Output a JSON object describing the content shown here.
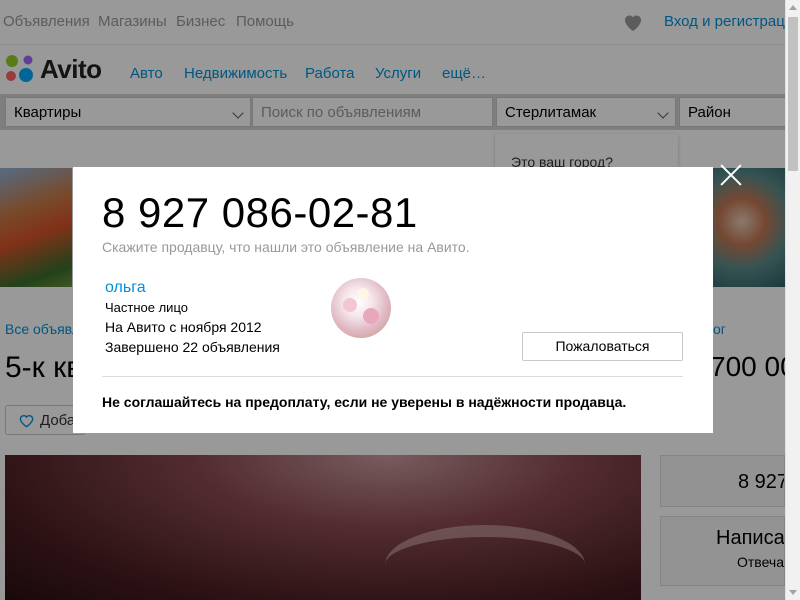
{
  "topbar": {
    "links": [
      "Объявления",
      "Магазины",
      "Бизнес",
      "Помощь"
    ],
    "favorites_icon": "heart-icon",
    "login_label": "Вход и регистрация"
  },
  "header": {
    "logo_text": "Avito",
    "nav": [
      "Авто",
      "Недвижимость",
      "Работа",
      "Услуги",
      "ещё…"
    ]
  },
  "search": {
    "category_value": "Квартиры",
    "query_placeholder": "Поиск по объявлениям",
    "city_value": "Стерлитамак",
    "district_value": "Район",
    "city_popup_text": "Это ваш город?"
  },
  "listing": {
    "breadcrumb": "Все объявления",
    "breadcrumb_right": "ог",
    "title_visible": "5-к кв",
    "price_visible": "700 00",
    "favorite_label": "Добавить",
    "side_phone_visible": "8 927",
    "side_message_label": "Написать",
    "side_message_sub": "Отвечает"
  },
  "modal": {
    "phone": "8 927 086-02-81",
    "hint": "Скажите продавцу, что нашли это объявление на Авито.",
    "seller_name": "ольга",
    "seller_type": "Частное лицо",
    "seller_since": "На Авито с ноября 2012",
    "seller_completed": "Завершено 22 объявления",
    "report_label": "Пожаловаться",
    "warning": "Не соглашайтесь на предоплату, если не уверены в надёжности продавца.",
    "close_icon": "close-icon"
  },
  "colors": {
    "link": "#0091d9",
    "overlay": "rgba(0,0,0,0.4)",
    "muted": "#999999"
  }
}
